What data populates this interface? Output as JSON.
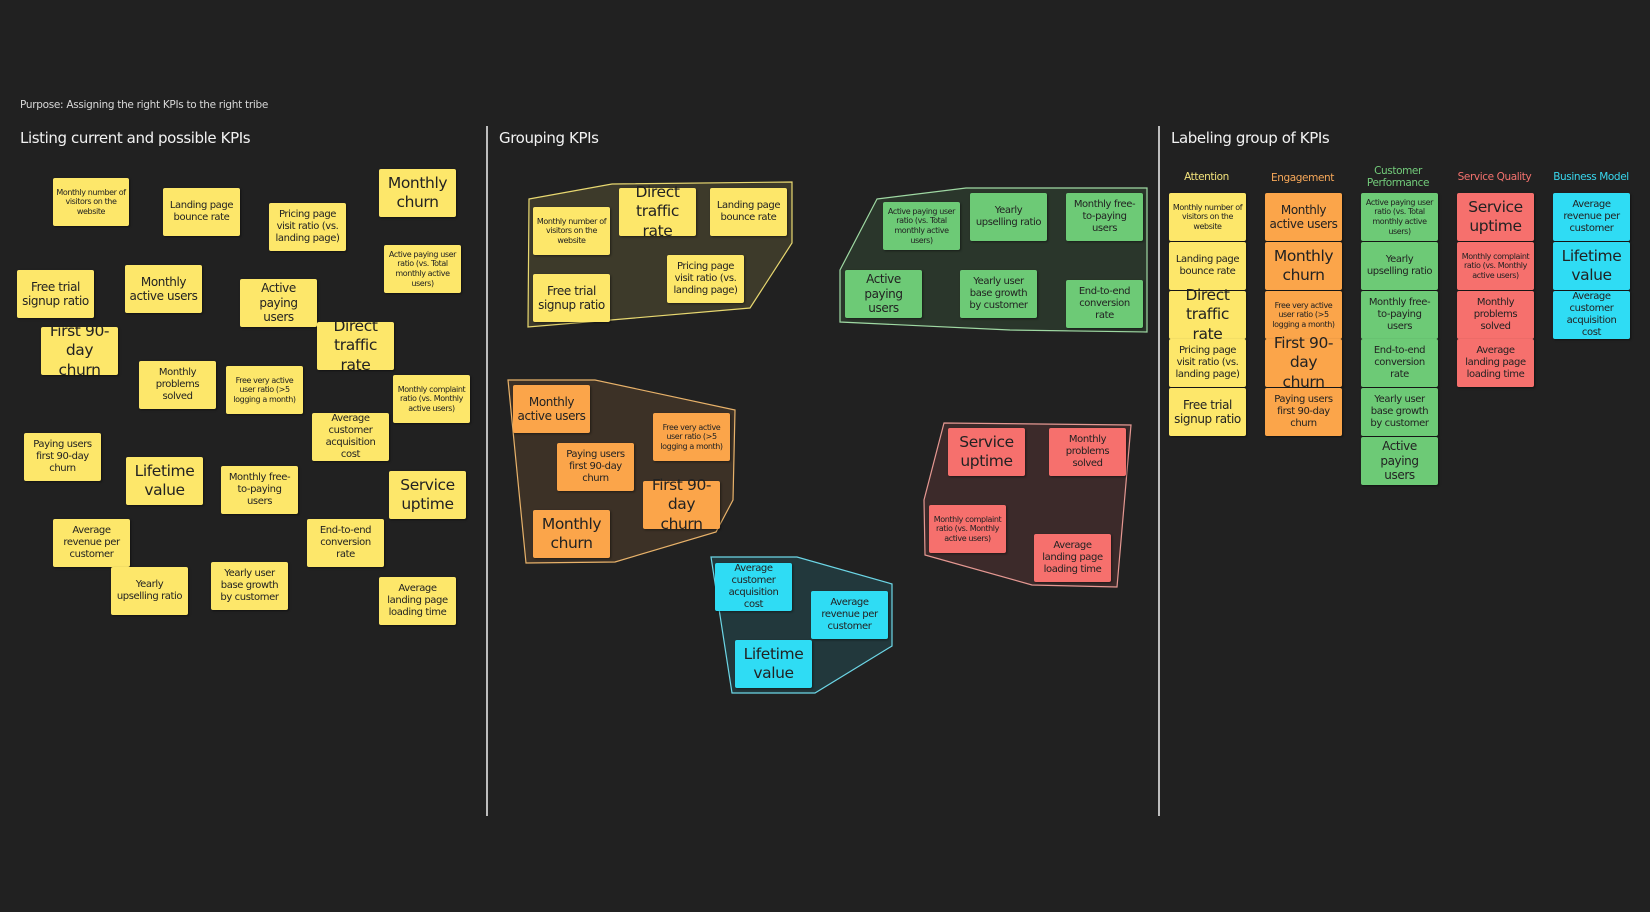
{
  "purpose": "Purpose: Assigning the right KPIs to the right tribe",
  "sections": {
    "listing": "Listing current and possible KPIs",
    "grouping": "Grouping KPIs",
    "labeling": "Labeling group of KPIs"
  },
  "colors": {
    "background": "#212121",
    "attention": "#fde76a",
    "engagement": "#fba54a",
    "customer_performance": "#6dca76",
    "service_quality": "#f6706d",
    "business_model": "#2fdcf4"
  },
  "kpis": {
    "monthly_visitors": "Monthly number of visitors on the website",
    "landing_bounce": "Landing page bounce rate",
    "pricing_visit": "Pricing page visit ratio (vs. landing page)",
    "monthly_churn": "Monthly churn",
    "active_paying_ratio": "Active paying user ratio (vs. Total monthly active users)",
    "free_trial": "Free trial signup ratio",
    "mau": "Monthly active users",
    "active_paying": "Active paying users",
    "first90": "First 90-day churn",
    "direct_traffic": "Direct traffic rate",
    "problems_solved": "Monthly problems solved",
    "free_very_active": "Free very active user ratio (>5 logging a month)",
    "complaint_ratio": "Monthly complaint ratio (vs. Monthly active users)",
    "cac": "Average customer acquisition cost",
    "paying_first90": "Paying users first 90-day churn",
    "ltv": "Lifetime value",
    "free_to_paying": "Monthly free-to-paying users",
    "service_uptime": "Service uptime",
    "arpc": "Average revenue per customer",
    "e2e_conversion": "End-to-end conversion rate",
    "yearly_upsell": "Yearly upselling ratio",
    "yearly_growth": "Yearly user base growth by customer",
    "landing_loading": "Average landing page loading time"
  },
  "labeling": {
    "columns": [
      {
        "label": "Attention"
      },
      {
        "label": "Engagement"
      },
      {
        "label": "Customer Performance"
      },
      {
        "label": "Service Quality"
      },
      {
        "label": "Business Model"
      }
    ]
  }
}
